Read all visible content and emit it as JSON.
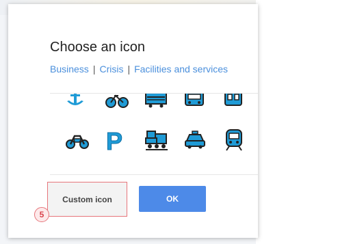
{
  "dialog": {
    "title": "Choose an icon",
    "categories": [
      "Business",
      "Crisis",
      "Facilities and services"
    ],
    "category_separator": "|",
    "icon_color": "#1f9bd6",
    "icons_row1": [
      "anchor-icon",
      "bicycle-icon",
      "train-car-icon",
      "bus-icon",
      "tram-icon"
    ],
    "icons_row2": [
      "motorbike-icon",
      "parking-icon",
      "locomotive-icon",
      "taxi-icon",
      "subway-icon"
    ],
    "parking_letter": "P",
    "buttons": {
      "custom_label": "Custom icon",
      "ok_label": "OK"
    },
    "step_badge": "5",
    "colors": {
      "link": "#4a8fdc",
      "ok_button": "#4d8ae8",
      "highlight": "#e6747a"
    }
  }
}
